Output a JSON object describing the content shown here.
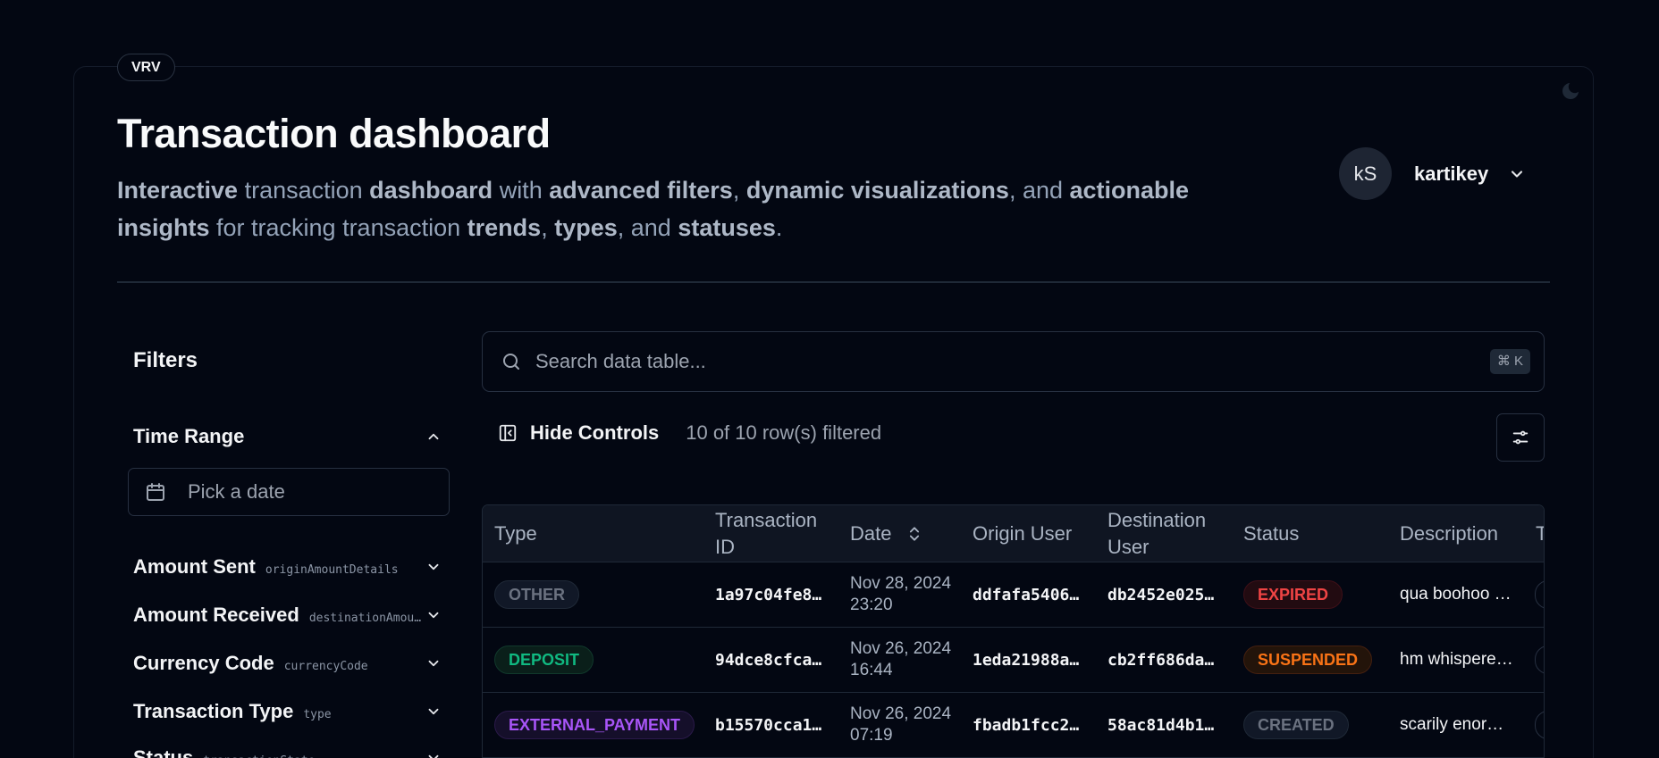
{
  "brand": "VRV",
  "header": {
    "title": "Transaction dashboard",
    "subtitle": {
      "s1": "Interactive",
      "s2": " transaction ",
      "s3": "dashboard",
      "s4": " with ",
      "s5": "advanced filters",
      "s6": ", ",
      "s7": "dynamic visualizations",
      "s8": ", and ",
      "s9": "actionable insights",
      "s10": " for tracking transaction ",
      "s11": "trends",
      "s12": ", ",
      "s13": "types",
      "s14": ", and ",
      "s15": "statuses",
      "s16": "."
    }
  },
  "user": {
    "initials": "kS",
    "name": "kartikey"
  },
  "filters": {
    "title": "Filters",
    "time_range": {
      "label": "Time Range",
      "placeholder": "Pick a date"
    },
    "items": [
      {
        "label": "Amount Sent",
        "key": "originAmountDetails"
      },
      {
        "label": "Amount Received",
        "key": "destinationAmountDetails"
      },
      {
        "label": "Currency Code",
        "key": "currencyCode"
      },
      {
        "label": "Transaction Type",
        "key": "type"
      },
      {
        "label": "Status",
        "key": "transactionState"
      }
    ]
  },
  "search": {
    "placeholder": "Search data table...",
    "shortcut": "⌘ K"
  },
  "controls": {
    "hide_label": "Hide Controls",
    "row_count": "10 of 10 row(s) filtered"
  },
  "table": {
    "columns": [
      "Type",
      "Transaction ID",
      "Date",
      "Origin User",
      "Destination User",
      "Status",
      "Description",
      "T"
    ],
    "rows": [
      {
        "type": "OTHER",
        "id": "1a97c04fe8…",
        "date": "Nov 28, 2024 23:20",
        "origin": "ddfafa5406…",
        "dest": "db2452e025…",
        "status": "EXPIRED",
        "desc": "qua boohoo …"
      },
      {
        "type": "DEPOSIT",
        "id": "94dce8cfca…",
        "date": "Nov 26, 2024 16:44",
        "origin": "1eda21988a…",
        "dest": "cb2ff686da…",
        "status": "SUSPENDED",
        "desc": "hm whispere…"
      },
      {
        "type": "EXTERNAL_PAYMENT",
        "id": "b15570cca1…",
        "date": "Nov 26, 2024 07:19",
        "origin": "fbadb1fcc2…",
        "dest": "58ac81d4b1…",
        "status": "CREATED",
        "desc": "scarily enor…"
      }
    ]
  },
  "colors": {
    "background": "#030712",
    "deposit": "#10b981",
    "external_payment": "#a855f7",
    "expired": "#ef4444",
    "suspended": "#f97316"
  }
}
